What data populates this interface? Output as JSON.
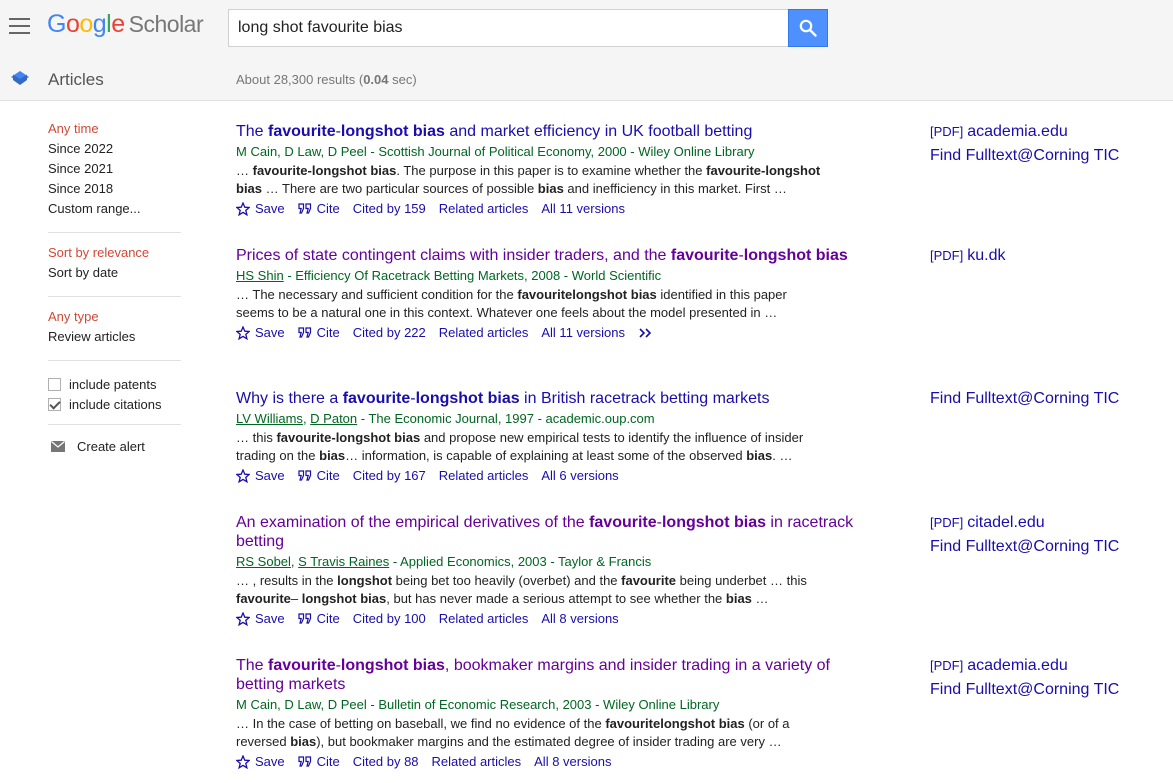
{
  "header": {
    "logo_letters": [
      "G",
      "o",
      "o",
      "g",
      "l",
      "e"
    ],
    "logo_product": "Scholar",
    "search_value": "long shot favourite bias"
  },
  "subheader": {
    "section": "Articles",
    "results_prefix": "About 28,300 results (",
    "results_time": "0.04",
    "results_suffix": " sec)"
  },
  "sidebar": {
    "time": [
      "Any time",
      "Since 2022",
      "Since 2021",
      "Since 2018",
      "Custom range..."
    ],
    "sort": [
      "Sort by relevance",
      "Sort by date"
    ],
    "type": [
      "Any type",
      "Review articles"
    ],
    "checks": [
      {
        "label": "include patents",
        "checked": false
      },
      {
        "label": "include citations",
        "checked": true
      }
    ],
    "create_alert": "Create alert"
  },
  "results": [
    {
      "title": [
        {
          "t": "The "
        },
        {
          "t": "favourite",
          "b": true
        },
        {
          "t": "-"
        },
        {
          "t": "longshot bias",
          "b": true
        },
        {
          "t": " and market efficiency in UK football betting"
        }
      ],
      "title_color": "blue",
      "meta": [
        {
          "t": "M Cain, D Law, D Peel - Scottish Journal of Political Economy, 2000 - Wiley Online Library"
        }
      ],
      "snippet": [
        {
          "t": "… "
        },
        {
          "t": "favourite-longshot bias",
          "b": true
        },
        {
          "t": ". The purpose in this paper is to examine whether the "
        },
        {
          "t": "favourite-longshot bias",
          "b": true
        },
        {
          "t": " … There are two particular sources of possible "
        },
        {
          "t": "bias",
          "b": true
        },
        {
          "t": " and inefficiency in this market. First …"
        }
      ],
      "links": {
        "save": "Save",
        "cite": "Cite",
        "cited": "Cited by 159",
        "related": "Related articles",
        "versions": "All 11 versions"
      },
      "side": [
        {
          "tag": "[PDF]",
          "text": "academia.edu"
        },
        {
          "tag": "",
          "text": "Find Fulltext@Corning TIC"
        }
      ]
    },
    {
      "title": [
        {
          "t": "Prices of state contingent claims with insider traders, and the "
        },
        {
          "t": "favourite",
          "b": true
        },
        {
          "t": "-"
        },
        {
          "t": "longshot bias",
          "b": true
        }
      ],
      "title_color": "purple",
      "meta": [
        {
          "t": "HS Shin",
          "a": true
        },
        {
          "t": " - Efficiency Of Racetrack Betting Markets, 2008 - World Scientific"
        }
      ],
      "snippet": [
        {
          "t": "… The necessary and sufficient condition for the "
        },
        {
          "t": "favouritelongshot bias",
          "b": true
        },
        {
          "t": " identified in this paper seems to be a natural one in this context. Whatever one feels about the model presented in …"
        }
      ],
      "links": {
        "save": "Save",
        "cite": "Cite",
        "cited": "Cited by 222",
        "related": "Related articles",
        "versions": "All 11 versions"
      },
      "more": true,
      "side": [
        {
          "tag": "[PDF]",
          "text": "ku.dk"
        }
      ]
    },
    {
      "title": [
        {
          "t": "Why is there a "
        },
        {
          "t": "favourite",
          "b": true
        },
        {
          "t": "-"
        },
        {
          "t": "longshot bias",
          "b": true
        },
        {
          "t": " in British racetrack betting markets"
        }
      ],
      "title_color": "blue",
      "meta": [
        {
          "t": "LV Williams",
          "a": true
        },
        {
          "t": ", "
        },
        {
          "t": "D Paton",
          "a": true
        },
        {
          "t": " - The Economic Journal, 1997 - academic.oup.com"
        }
      ],
      "snippet": [
        {
          "t": "… this "
        },
        {
          "t": "favourite-longshot bias",
          "b": true
        },
        {
          "t": " and propose new empirical tests to identify the influence of insider trading on the "
        },
        {
          "t": "bias",
          "b": true
        },
        {
          "t": "… information, is capable of explaining at least some of the observed "
        },
        {
          "t": "bias",
          "b": true
        },
        {
          "t": ". …"
        }
      ],
      "links": {
        "save": "Save",
        "cite": "Cite",
        "cited": "Cited by 167",
        "related": "Related articles",
        "versions": "All 6 versions"
      },
      "side": [
        {
          "tag": "",
          "text": "Find Fulltext@Corning TIC"
        }
      ]
    },
    {
      "title": [
        {
          "t": "An examination of the empirical derivatives of the "
        },
        {
          "t": "favourite",
          "b": true
        },
        {
          "t": "-"
        },
        {
          "t": "longshot bias",
          "b": true
        },
        {
          "t": " in racetrack betting"
        }
      ],
      "title_color": "purple",
      "meta": [
        {
          "t": "RS Sobel",
          "a": true
        },
        {
          "t": ", "
        },
        {
          "t": "S Travis Raines",
          "a": true
        },
        {
          "t": " - Applied Economics, 2003 - Taylor & Francis"
        }
      ],
      "snippet": [
        {
          "t": "… , results in the "
        },
        {
          "t": "longshot",
          "b": true
        },
        {
          "t": " being bet too heavily (overbet) and the "
        },
        {
          "t": "favourite",
          "b": true
        },
        {
          "t": " being underbet … this "
        },
        {
          "t": "favourite",
          "b": true
        },
        {
          "t": "– "
        },
        {
          "t": "longshot bias",
          "b": true
        },
        {
          "t": ", but has never made a serious attempt to see whether the "
        },
        {
          "t": "bias",
          "b": true
        },
        {
          "t": " …"
        }
      ],
      "links": {
        "save": "Save",
        "cite": "Cite",
        "cited": "Cited by 100",
        "related": "Related articles",
        "versions": "All 8 versions"
      },
      "side": [
        {
          "tag": "[PDF]",
          "text": "citadel.edu"
        },
        {
          "tag": "",
          "text": "Find Fulltext@Corning TIC"
        }
      ]
    },
    {
      "title": [
        {
          "t": "The "
        },
        {
          "t": "favourite",
          "b": true
        },
        {
          "t": "-"
        },
        {
          "t": "longshot bias",
          "b": true
        },
        {
          "t": ", bookmaker margins and insider trading in a variety of betting markets"
        }
      ],
      "title_color": "purple",
      "meta": [
        {
          "t": "M Cain, D Law, D Peel - Bulletin of Economic Research, 2003 - Wiley Online Library"
        }
      ],
      "snippet": [
        {
          "t": "… In the case of betting on baseball, we find no evidence of the "
        },
        {
          "t": "favouritelongshot bias",
          "b": true
        },
        {
          "t": " (or of a reversed "
        },
        {
          "t": "bias",
          "b": true
        },
        {
          "t": "), but bookmaker margins and the estimated degree of insider trading are very …"
        }
      ],
      "links": {
        "save": "Save",
        "cite": "Cite",
        "cited": "Cited by 88",
        "related": "Related articles",
        "versions": "All 8 versions"
      },
      "side": [
        {
          "tag": "[PDF]",
          "text": "academia.edu"
        },
        {
          "tag": "",
          "text": "Find Fulltext@Corning TIC"
        }
      ]
    }
  ]
}
